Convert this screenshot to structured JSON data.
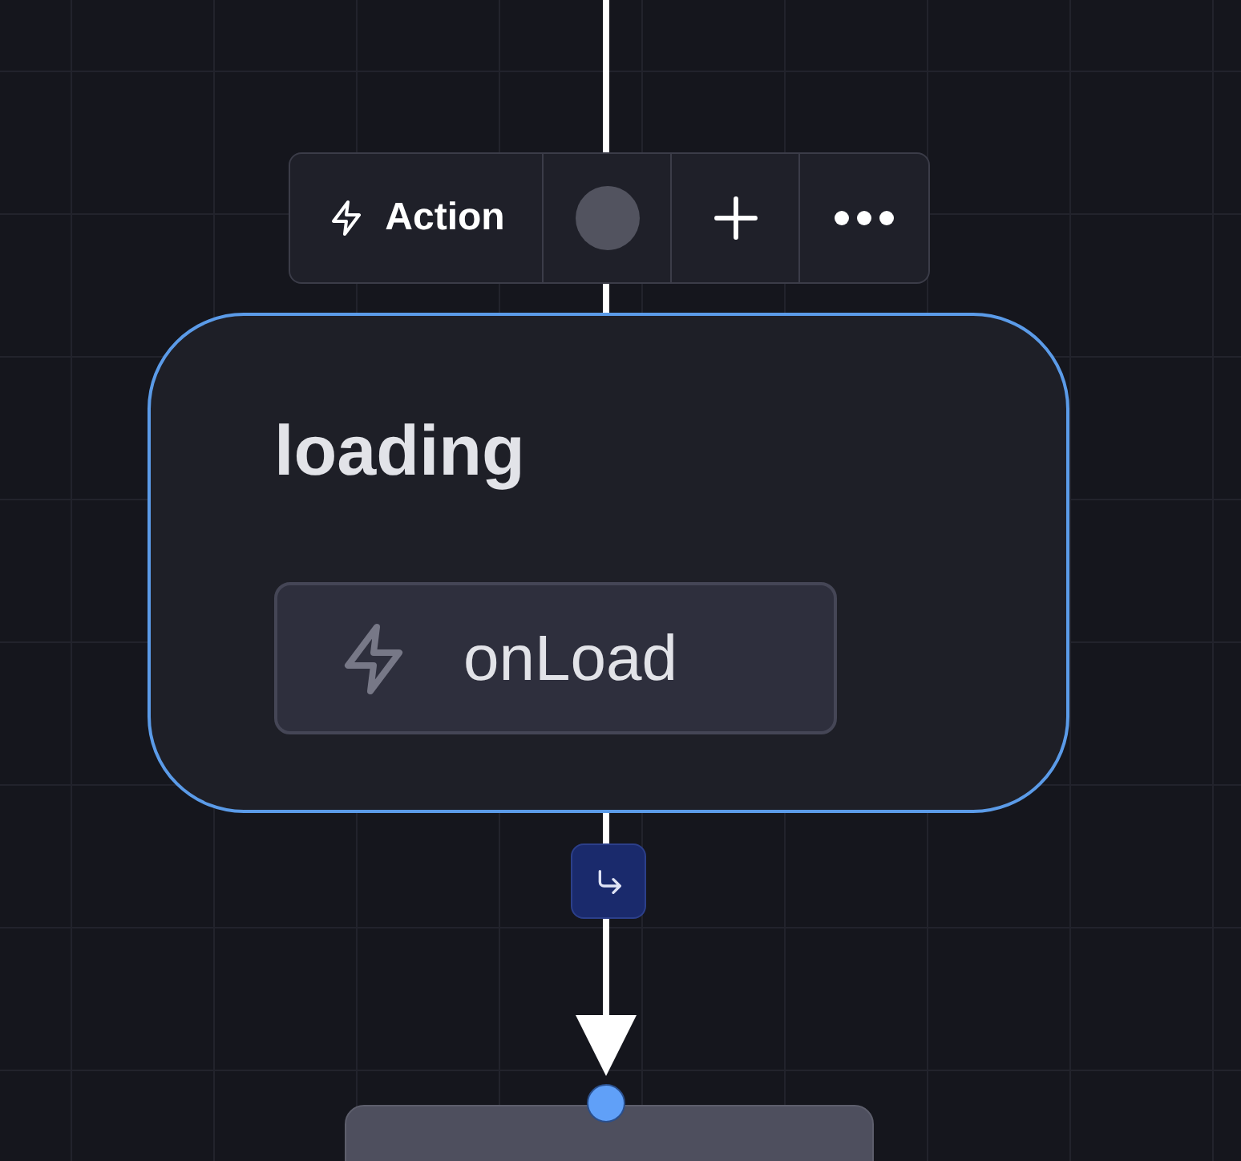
{
  "toolbar": {
    "label": "Action"
  },
  "node": {
    "title": "loading",
    "selected": true,
    "events": [
      {
        "label": "onLoad"
      }
    ]
  }
}
